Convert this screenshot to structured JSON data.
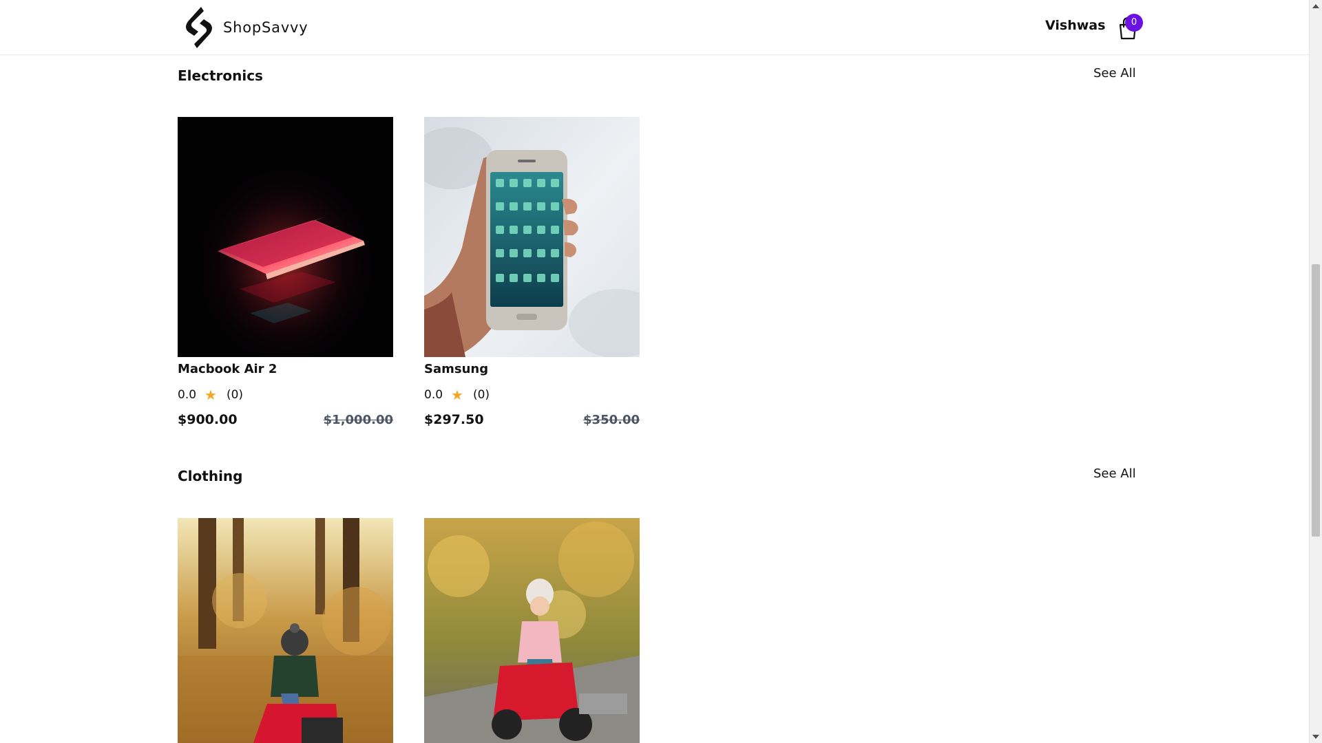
{
  "brand": {
    "name": "ShopSavvy"
  },
  "header": {
    "user_name": "Vishwas",
    "cart_count": "0"
  },
  "sections": [
    {
      "title": "Electronics",
      "see_all": "See All",
      "products": [
        {
          "name": "Macbook Air 2",
          "rating": "0.0",
          "reviews": "(0)",
          "price": "$900.00",
          "old_price": "$1,000.00"
        },
        {
          "name": "Samsung",
          "rating": "0.0",
          "reviews": "(0)",
          "price": "$297.50",
          "old_price": "$350.00"
        }
      ]
    },
    {
      "title": "Clothing",
      "see_all": "See All",
      "products": [
        {
          "name": "",
          "rating": "",
          "reviews": "",
          "price": "",
          "old_price": ""
        },
        {
          "name": "",
          "rating": "",
          "reviews": "",
          "price": "",
          "old_price": ""
        }
      ]
    }
  ],
  "colors": {
    "accent": "#6b12e0",
    "star": "#f5a623",
    "old_price": "#4b5563"
  }
}
